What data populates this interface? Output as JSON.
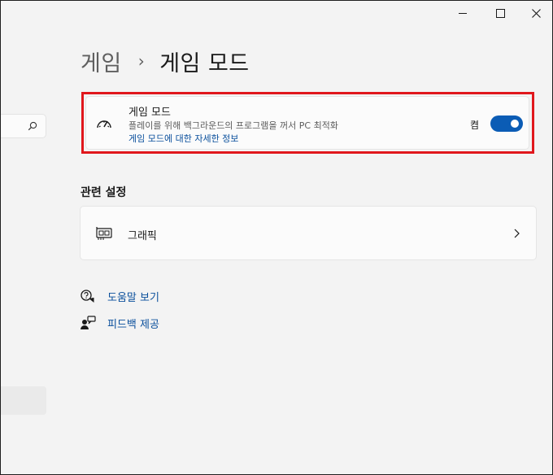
{
  "window": {
    "controls": {
      "minimize_icon": "minimize-icon",
      "maximize_icon": "maximize-icon",
      "close_icon": "close-icon"
    }
  },
  "sidebar": {
    "search_icon": "search-icon"
  },
  "breadcrumb": {
    "parent": "게임",
    "separator": "›",
    "current": "게임 모드"
  },
  "game_mode": {
    "icon": "speedometer-icon",
    "title": "게임 모드",
    "description": "플레이를 위해 백그라운드의 프로그램을 꺼서 PC 최적화",
    "link": "게임 모드에 대한 자세한 정보",
    "toggle_label": "켬",
    "toggle_on": true,
    "accent_color": "#0b5cb5"
  },
  "related_settings": {
    "title": "관련 설정",
    "items": [
      {
        "icon": "graphics-card-icon",
        "label": "그래픽"
      }
    ]
  },
  "help": {
    "items": [
      {
        "icon": "help-chat-icon",
        "label": "도움말 보기"
      },
      {
        "icon": "feedback-icon",
        "label": "피드백 제공"
      }
    ]
  },
  "highlight_color": "#e0171c"
}
